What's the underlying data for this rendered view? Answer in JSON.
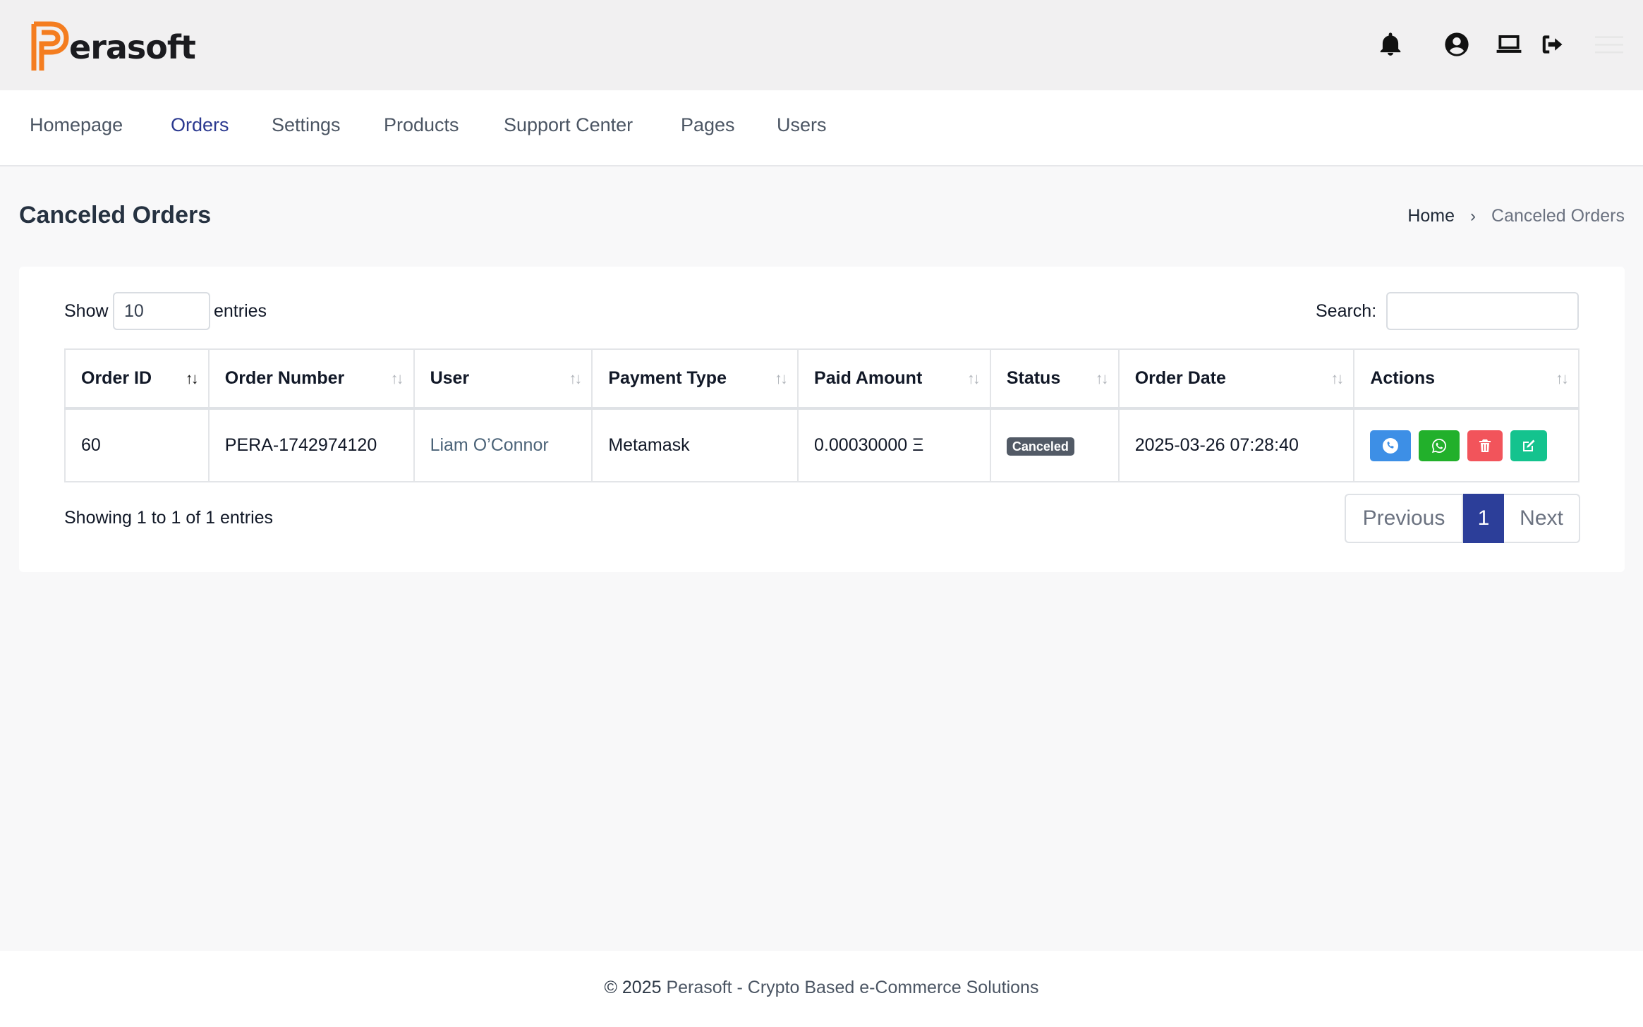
{
  "brand": {
    "name": "erasoft",
    "logo_color": "#f47d20"
  },
  "top_icons": [
    "bell-icon",
    "user-circle-icon",
    "laptop-icon",
    "sign-out-icon",
    "menu-icon"
  ],
  "nav": {
    "items": [
      {
        "label": "Homepage"
      },
      {
        "label": "Orders",
        "active": true
      },
      {
        "label": "Settings"
      },
      {
        "label": "Products"
      },
      {
        "label": "Support Center"
      },
      {
        "label": "Pages"
      },
      {
        "label": "Users"
      }
    ]
  },
  "page": {
    "title": "Canceled Orders"
  },
  "breadcrumb": {
    "home": "Home",
    "current": "Canceled Orders"
  },
  "table_controls": {
    "show_label": "Show",
    "entries_value": "10",
    "entries_label": "entries",
    "search_label": "Search:",
    "search_value": ""
  },
  "table": {
    "columns": [
      "Order ID",
      "Order Number",
      "User",
      "Payment Type",
      "Paid Amount",
      "Status",
      "Order Date",
      "Actions"
    ],
    "rows": [
      {
        "order_id": "60",
        "order_number": "PERA-1742974120",
        "user": "Liam O’Connor",
        "payment_type": "Metamask",
        "paid_amount": "0.00030000 Ξ",
        "status": "Canceled",
        "order_date": "2025-03-26 07:28:40",
        "actions": [
          "phone-icon",
          "whatsapp-icon",
          "trash-icon",
          "edit-icon"
        ]
      }
    ]
  },
  "pagination": {
    "info": "Showing 1 to 1 of 1 entries",
    "previous": "Previous",
    "current": "1",
    "next": "Next"
  },
  "footer": {
    "copyright": "© 2025",
    "text": "Perasoft - Crypto Based e-Commerce Solutions"
  },
  "colors": {
    "accent": "#2b3990",
    "phone": "#3d8fe6",
    "whatsapp": "#22b02b",
    "delete": "#f2545b",
    "edit": "#14c38e",
    "badge": "#525a66"
  }
}
